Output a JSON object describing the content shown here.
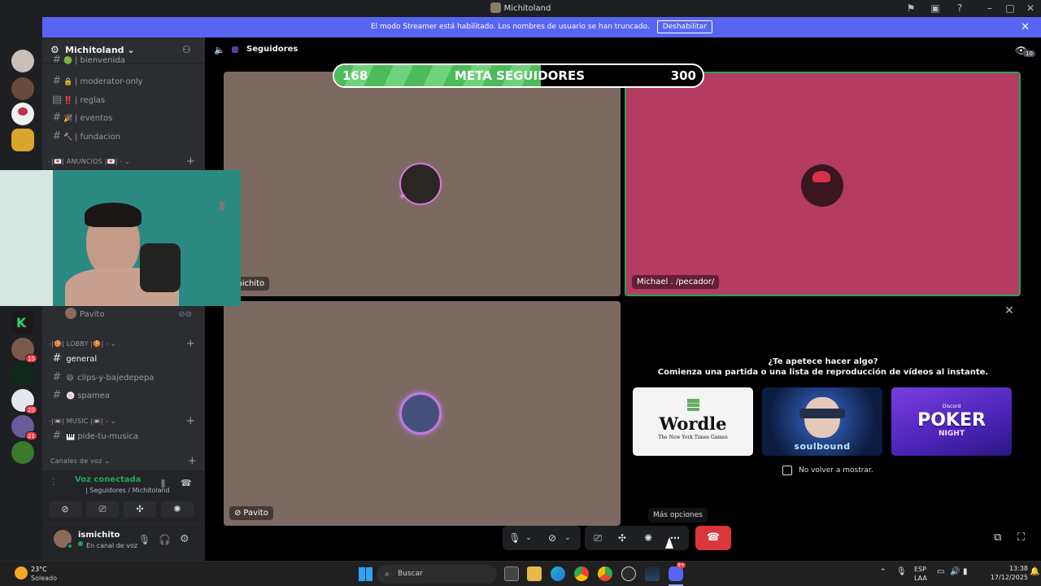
{
  "window": {
    "title": "Michitoland"
  },
  "banner": {
    "text": "El modo Streamer está habilitado. Los nombres de usuario se han truncado.",
    "button": "Deshabilitar"
  },
  "server": {
    "name": "Michitoland ⌄"
  },
  "channels": [
    {
      "name": "| bienvenida",
      "emoji": "🟢"
    },
    {
      "name": "| moderator-only",
      "emoji": "🔒"
    },
    {
      "name": "| reglas",
      "emoji": "‼️"
    },
    {
      "name": "| eventos",
      "emoji": "🎉"
    },
    {
      "name": "| fundacion",
      "emoji": "🔨"
    }
  ],
  "categories": {
    "anuncios": "-|💌| ANUNCIOS |💌| - ⌄",
    "lobby": "-|🍪| LOBBY |🍪| - ⌄",
    "music": "-|📼| MUSIC |📼| - ⌄",
    "voice": "Canales de voz ⌄"
  },
  "voice_member": "Pavito",
  "lobby_channels": [
    {
      "name": "general",
      "emoji": "",
      "active": true
    },
    {
      "name": "clips-y-bajedepepa",
      "emoji": "😄",
      "active": false
    },
    {
      "name": "spamea",
      "emoji": "🍥",
      "active": false
    }
  ],
  "music_channels": [
    {
      "name": "pide-tu-musica",
      "emoji": "🎹"
    }
  ],
  "server_badges": [
    "15",
    "20",
    "21"
  ],
  "voice_panel": {
    "status": "Voz conectada",
    "location": "| Seguidores / Michitoland"
  },
  "user": {
    "name": "ismichito",
    "status": "En canal de voz"
  },
  "main": {
    "channel_title": "Seguidores",
    "viewer_count": "10"
  },
  "goal": {
    "title": "META SEGUIDORES",
    "current": 168,
    "target": 300
  },
  "tiles": {
    "t1_label": "michito",
    "t2_label": "Michael . /pecador/",
    "t3_label": "Pavito"
  },
  "activity": {
    "question": "¿Te apetece hacer algo?",
    "subtitle": "Comienza una partida o una lista de reproducción de vídeos al instante.",
    "cards": [
      "Wordle",
      "soulbound",
      "POKER"
    ],
    "wordle_sub": "The New York Times Games",
    "poker_sub": "NIGHT",
    "poker_brand": "Discord",
    "checkbox_label": "No volver a mostrar."
  },
  "tooltip": "Más opciones",
  "taskbar": {
    "weather_temp": "23°C",
    "weather_desc": "Soleado",
    "search": "Buscar",
    "lang1": "ESP",
    "lang2": "LAA",
    "time": "13:38",
    "date": "17/12/2025",
    "discord_badge": "9+"
  },
  "colors": {
    "blurple": "#5865f2",
    "tile_brown": "#7c6a62",
    "tile_pink": "#b43b62",
    "green": "#23a55a",
    "red": "#da373c"
  }
}
